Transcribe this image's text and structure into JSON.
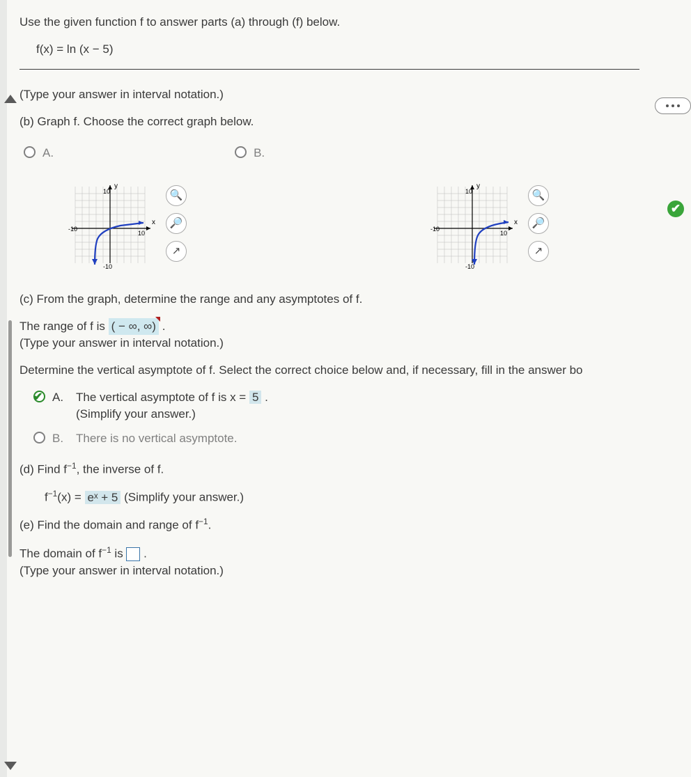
{
  "intro": "Use the given function f to answer parts (a) through (f) below.",
  "formula": "f(x) = ln (x − 5)",
  "hint_prev": "(Type your answer in interval notation.)",
  "part_b": {
    "prompt": "(b) Graph f. Choose the correct graph below.",
    "options": {
      "a": "A.",
      "b": "B."
    },
    "axis_x": "x",
    "axis_y": "y",
    "ticks": {
      "pos": "10",
      "neg": "-10"
    }
  },
  "part_c": {
    "prompt": "(c) From the graph, determine the range and any asymptotes of f.",
    "range_label_pre": "The range of f is ",
    "range_value": "( − ∞, ∞)",
    "range_label_post": ".",
    "hint": "(Type your answer in interval notation.)",
    "va_prompt": "Determine the vertical asymptote of f. Select the correct choice below and, if necessary, fill in the answer bo",
    "opt_a_pre": "The vertical asymptote of f is x = ",
    "opt_a_val": "5",
    "opt_a_post": ".",
    "opt_a_hint": "(Simplify your answer.)",
    "opt_b": "There is no vertical asymptote."
  },
  "part_d": {
    "prompt_pre": "(d) Find f",
    "prompt_sup": "−1",
    "prompt_post": ", the inverse of f.",
    "ans_pre": "f",
    "ans_sup": "−1",
    "ans_mid": "(x) = ",
    "ans_val": "eˣ + 5",
    "ans_hint": "   (Simplify your answer.)"
  },
  "part_e": {
    "prompt_pre": "(e) Find the domain and range of f",
    "prompt_sup": "−1",
    "prompt_post": ".",
    "dom_pre": "The domain of f",
    "dom_sup": "−1",
    "dom_mid": " is ",
    "dom_post": ".",
    "hint": "(Type your answer in interval notation.)"
  },
  "labels": {
    "A": "A.",
    "B": "B."
  },
  "tools": {
    "zoom_in": "⊕",
    "zoom_out": "⊖",
    "popout": "⇱"
  }
}
